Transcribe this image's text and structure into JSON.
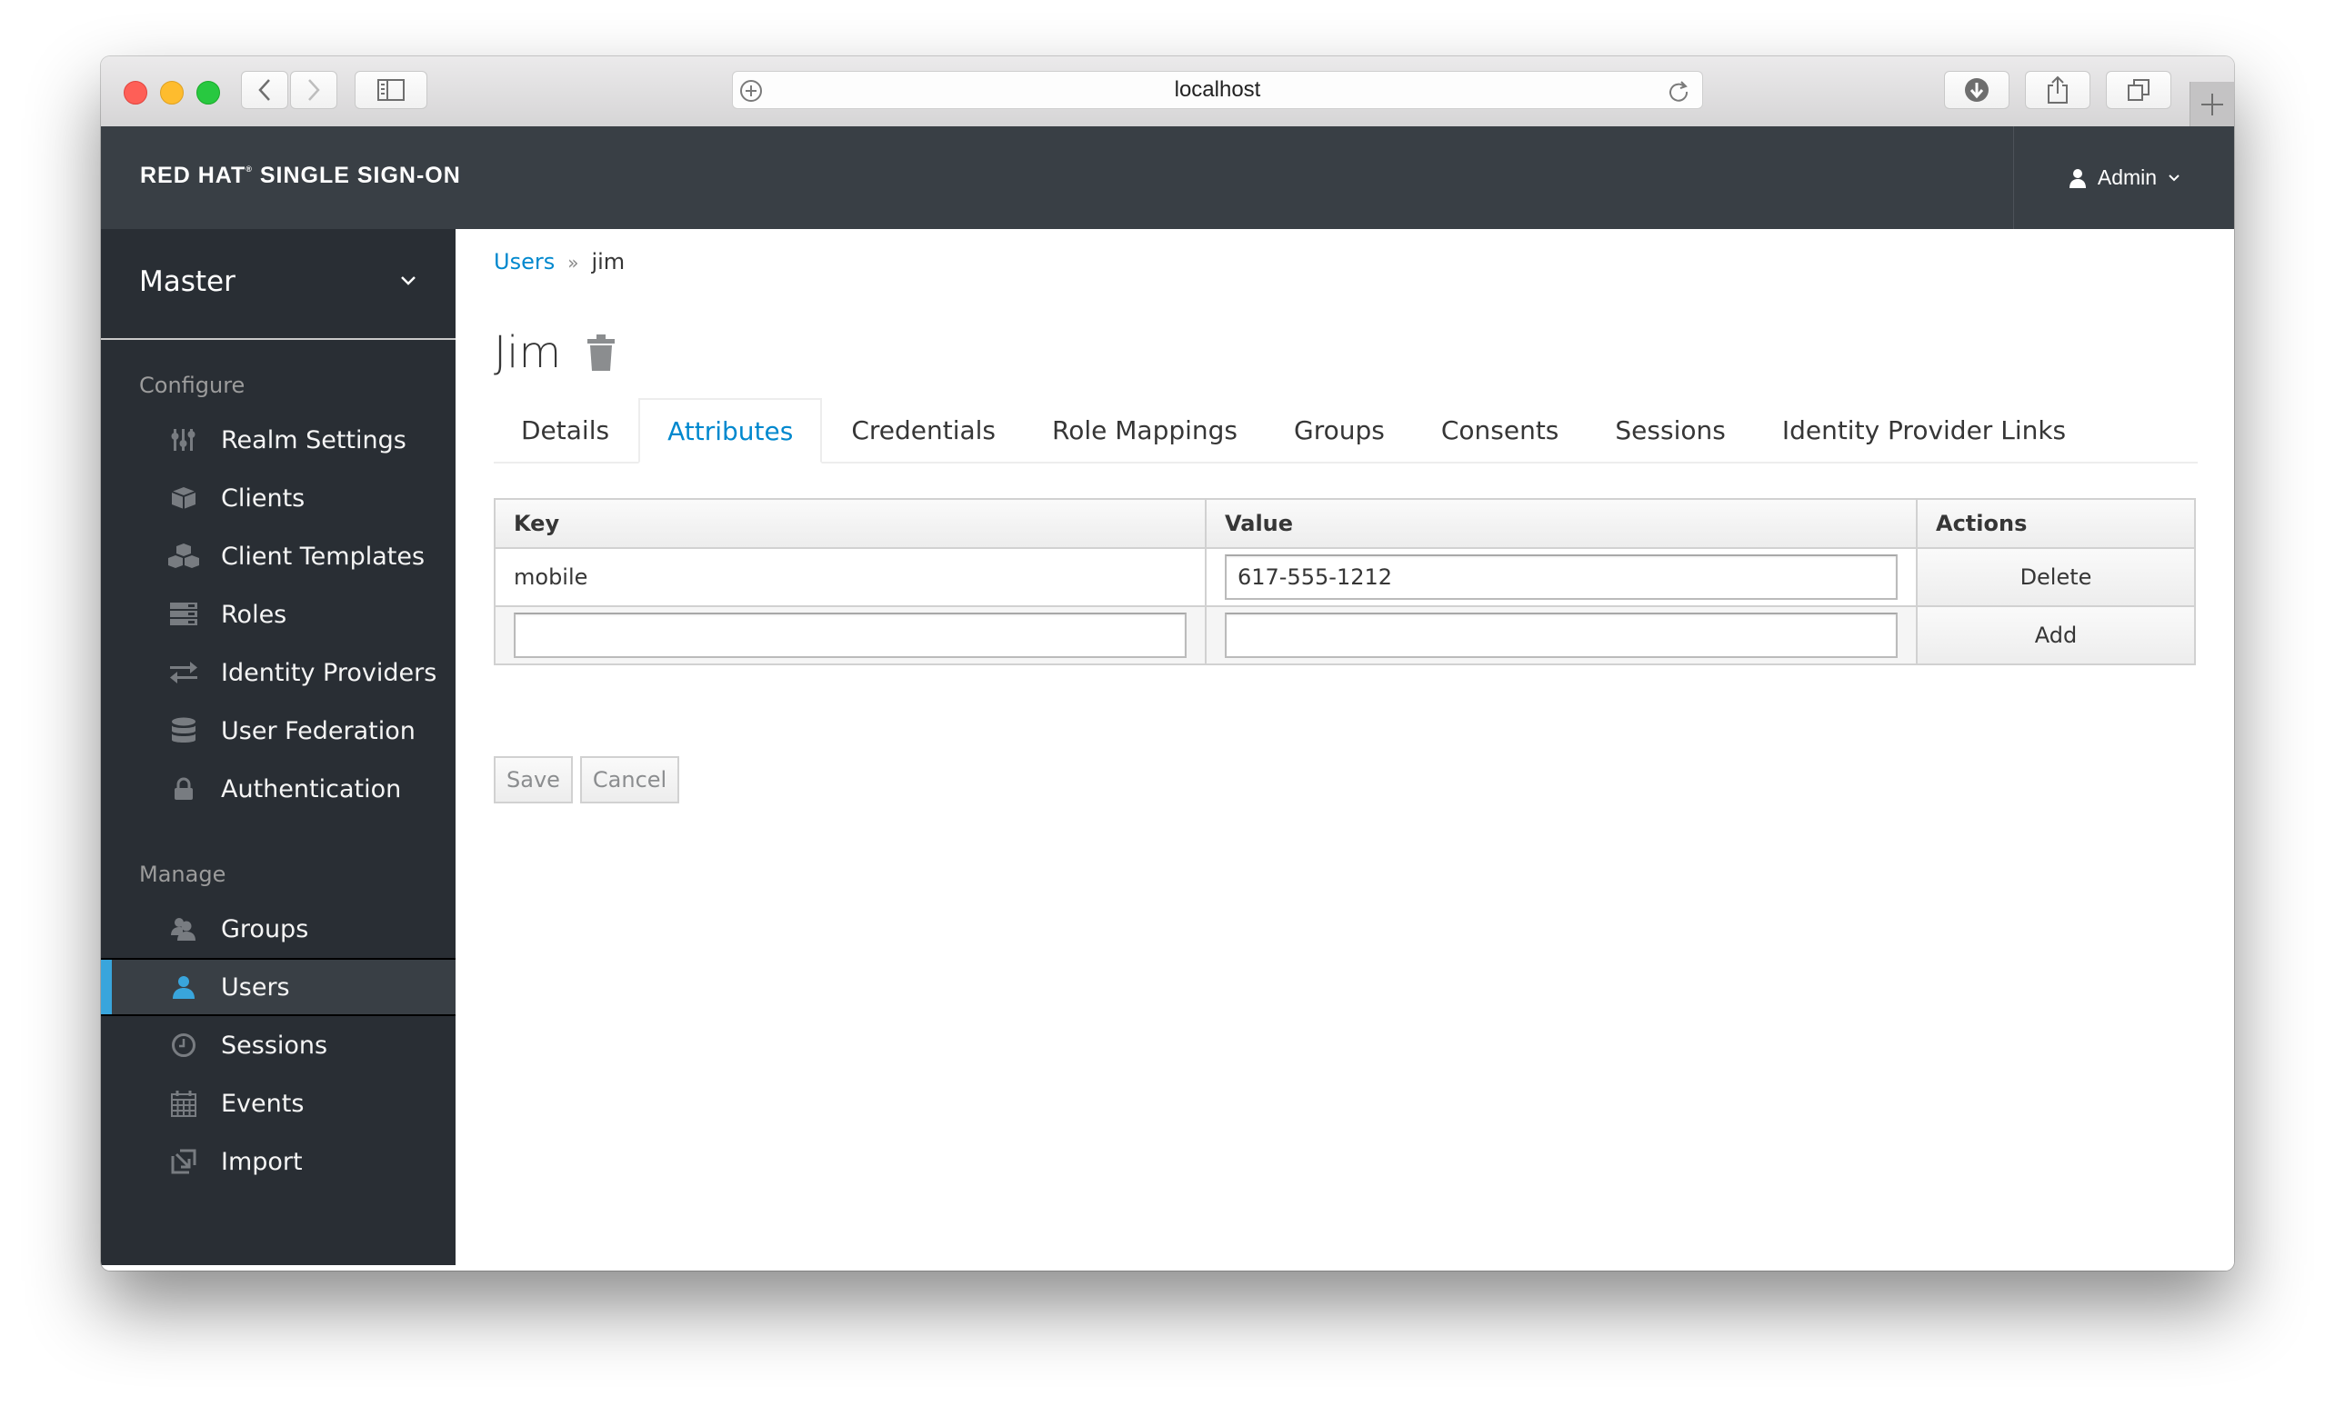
{
  "browser": {
    "url": "localhost",
    "buttons": {
      "back": "back",
      "forward": "forward",
      "sidebar": "sidebar",
      "downloads": "downloads",
      "share": "share",
      "tabs": "tabs",
      "new_tab": "new-tab"
    }
  },
  "header": {
    "brand_part1": "RED HAT",
    "brand_reg": "®",
    "brand_part2": " SINGLE SIGN-ON",
    "user_label": "Admin"
  },
  "sidebar": {
    "realm": "Master",
    "sections": [
      {
        "title": "Configure",
        "items": [
          {
            "label": "Realm Settings",
            "icon": "sliders-icon"
          },
          {
            "label": "Clients",
            "icon": "cube-icon"
          },
          {
            "label": "Client Templates",
            "icon": "cubes-icon"
          },
          {
            "label": "Roles",
            "icon": "server-list-icon"
          },
          {
            "label": "Identity Providers",
            "icon": "exchange-icon"
          },
          {
            "label": "User Federation",
            "icon": "database-icon"
          },
          {
            "label": "Authentication",
            "icon": "lock-icon"
          }
        ]
      },
      {
        "title": "Manage",
        "items": [
          {
            "label": "Groups",
            "icon": "users-icon"
          },
          {
            "label": "Users",
            "icon": "user-icon",
            "active": true
          },
          {
            "label": "Sessions",
            "icon": "clock-icon"
          },
          {
            "label": "Events",
            "icon": "calendar-icon"
          },
          {
            "label": "Import",
            "icon": "import-icon"
          }
        ]
      }
    ]
  },
  "main": {
    "breadcrumb": {
      "parent": "Users",
      "separator": "»",
      "current": "jim"
    },
    "title": "Jim",
    "tabs": [
      {
        "label": "Details"
      },
      {
        "label": "Attributes",
        "active": true
      },
      {
        "label": "Credentials"
      },
      {
        "label": "Role Mappings"
      },
      {
        "label": "Groups"
      },
      {
        "label": "Consents"
      },
      {
        "label": "Sessions"
      },
      {
        "label": "Identity Provider Links"
      }
    ],
    "table": {
      "headers": {
        "key": "Key",
        "value": "Value",
        "actions": "Actions"
      },
      "rows": [
        {
          "key": "mobile",
          "value": "617-555-1212",
          "action": "Delete"
        }
      ],
      "new_row": {
        "key": "",
        "value": "",
        "action": "Add"
      }
    },
    "buttons": {
      "save": "Save",
      "cancel": "Cancel"
    }
  },
  "colors": {
    "accent": "#0088ce",
    "active_indicator": "#39a5dc",
    "header_bg": "#393f45",
    "sidebar_bg": "#292e34"
  }
}
